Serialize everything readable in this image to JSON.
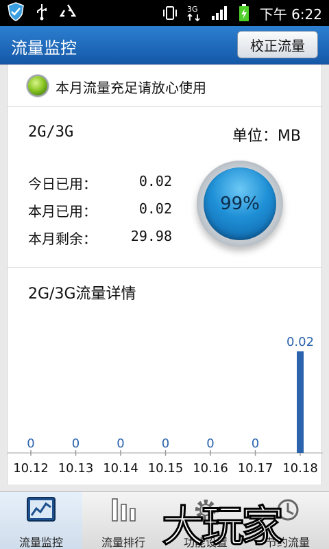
{
  "status_bar": {
    "time": "下午 6:22",
    "network_label": "3G",
    "left_icons": [
      "shield-icon",
      "usb-icon",
      "recycle-icon"
    ],
    "right_icons": [
      "vibrate-icon",
      "3g-data-icon",
      "signal-icon",
      "battery-charging-icon"
    ]
  },
  "header": {
    "title": "流量监控",
    "calibrate_button": "校正流量"
  },
  "status": {
    "message": "本月流量充足请放心使用",
    "indicator_color": "#8cc826"
  },
  "usage": {
    "network_type": "2G/3G",
    "unit_label": "单位：MB",
    "rows": [
      {
        "label": "今日已用：",
        "value": "0.02"
      },
      {
        "label": "本月已用：",
        "value": "0.02"
      },
      {
        "label": "本月剩余：",
        "value": "29.98"
      }
    ],
    "remaining_percent": "99%"
  },
  "chart_data": {
    "type": "bar",
    "title": "2G/3G流量详情",
    "categories": [
      "10.12",
      "10.13",
      "10.14",
      "10.15",
      "10.16",
      "10.17",
      "10.18"
    ],
    "values": [
      0,
      0,
      0,
      0,
      0,
      0,
      0.02
    ],
    "data_labels": [
      "0",
      "0",
      "0",
      "0",
      "0",
      "0",
      "0.02"
    ],
    "bar_color": "#2b63ad",
    "label_color": "#2b63ad"
  },
  "bottom_nav": {
    "items": [
      {
        "label": "流量监控",
        "icon": "chart-monitor-icon",
        "active": true
      },
      {
        "label": "流量排行",
        "icon": "ranking-bars-icon",
        "active": false
      },
      {
        "label": "功能设置",
        "icon": "gear-icon",
        "active": false
      },
      {
        "label": "节约流量",
        "icon": "save-traffic-icon",
        "active": false
      }
    ]
  },
  "watermark": {
    "text": "大玩家"
  }
}
